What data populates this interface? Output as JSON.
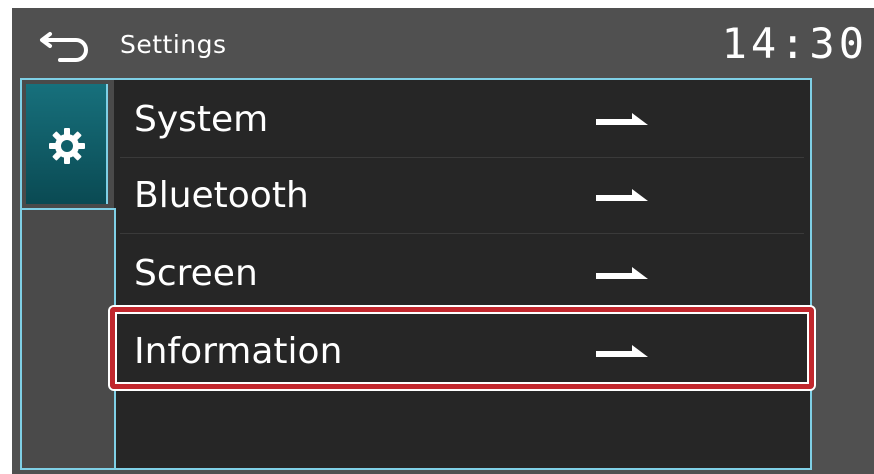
{
  "header": {
    "back_icon": "back-arrow-icon",
    "title": "Settings",
    "clock": "14:30"
  },
  "sidebar": {
    "active_tab_icon": "gear-icon"
  },
  "menu": {
    "items": [
      {
        "label": "System",
        "icon": "right-arrow-icon"
      },
      {
        "label": "Bluetooth",
        "icon": "right-arrow-icon"
      },
      {
        "label": "Screen",
        "icon": "right-arrow-icon"
      },
      {
        "label": "Information",
        "icon": "right-arrow-icon",
        "highlighted": true
      }
    ]
  },
  "colors": {
    "background": "#505050",
    "panel": "#262626",
    "accent_border": "#7fd0e6",
    "active_tab": "#0f5f69",
    "highlight": "#c1272d",
    "text": "#ffffff"
  }
}
